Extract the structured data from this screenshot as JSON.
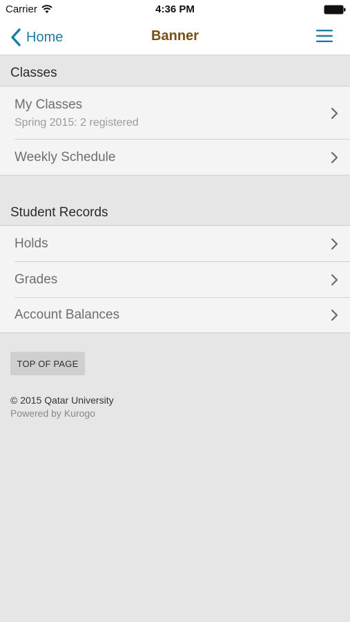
{
  "status_bar": {
    "carrier": "Carrier",
    "time": "4:36 PM",
    "wifi_icon": "wifi-icon",
    "battery_icon": "battery-icon"
  },
  "nav": {
    "back_label": "Home",
    "back_icon": "chevron-left-icon",
    "title": "Banner",
    "menu_icon": "hamburger-menu-icon",
    "accent_color": "#1d7da0",
    "title_color": "#7a4d12"
  },
  "sections": [
    {
      "header": "Classes",
      "items": [
        {
          "title": "My Classes",
          "subtitle": "Spring 2015: 2 registered"
        },
        {
          "title": "Weekly Schedule"
        }
      ]
    },
    {
      "header": "Student Records",
      "items": [
        {
          "title": "Holds"
        },
        {
          "title": "Grades"
        },
        {
          "title": "Account Balances"
        }
      ]
    }
  ],
  "footer": {
    "top_button": "TOP OF PAGE",
    "copyright": "© 2015 Qatar University",
    "powered_by": "Powered by Kurogo"
  }
}
